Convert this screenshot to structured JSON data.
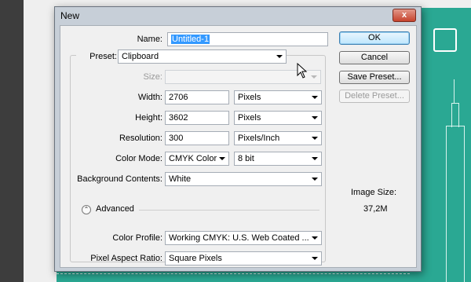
{
  "window": {
    "title": "New",
    "close_glyph": "x"
  },
  "form": {
    "name": {
      "label": "Name:",
      "value": "Untitled-1"
    },
    "preset": {
      "label": "Preset:",
      "value": "Clipboard"
    },
    "size": {
      "label": "Size:",
      "value": ""
    },
    "width": {
      "label": "Width:",
      "value": "2706",
      "unit": "Pixels"
    },
    "height": {
      "label": "Height:",
      "value": "3602",
      "unit": "Pixels"
    },
    "resolution": {
      "label": "Resolution:",
      "value": "300",
      "unit": "Pixels/Inch"
    },
    "color_mode": {
      "label": "Color Mode:",
      "value": "CMYK Color",
      "bits": "8 bit"
    },
    "background": {
      "label": "Background Contents:",
      "value": "White"
    },
    "advanced": {
      "label": "Advanced"
    },
    "color_profile": {
      "label": "Color Profile:",
      "value": "Working CMYK:  U.S. Web Coated ..."
    },
    "pixel_aspect": {
      "label": "Pixel Aspect Ratio:",
      "value": "Square Pixels"
    }
  },
  "buttons": {
    "ok": "OK",
    "cancel": "Cancel",
    "save_preset": "Save Preset...",
    "delete_preset": "Delete Preset..."
  },
  "image_size": {
    "label": "Image Size:",
    "value": "37,2M"
  },
  "colors": {
    "teal": "#2aa893",
    "frame": "#c7cfd8",
    "close": "#c7432d",
    "selection": "#3399ff"
  }
}
